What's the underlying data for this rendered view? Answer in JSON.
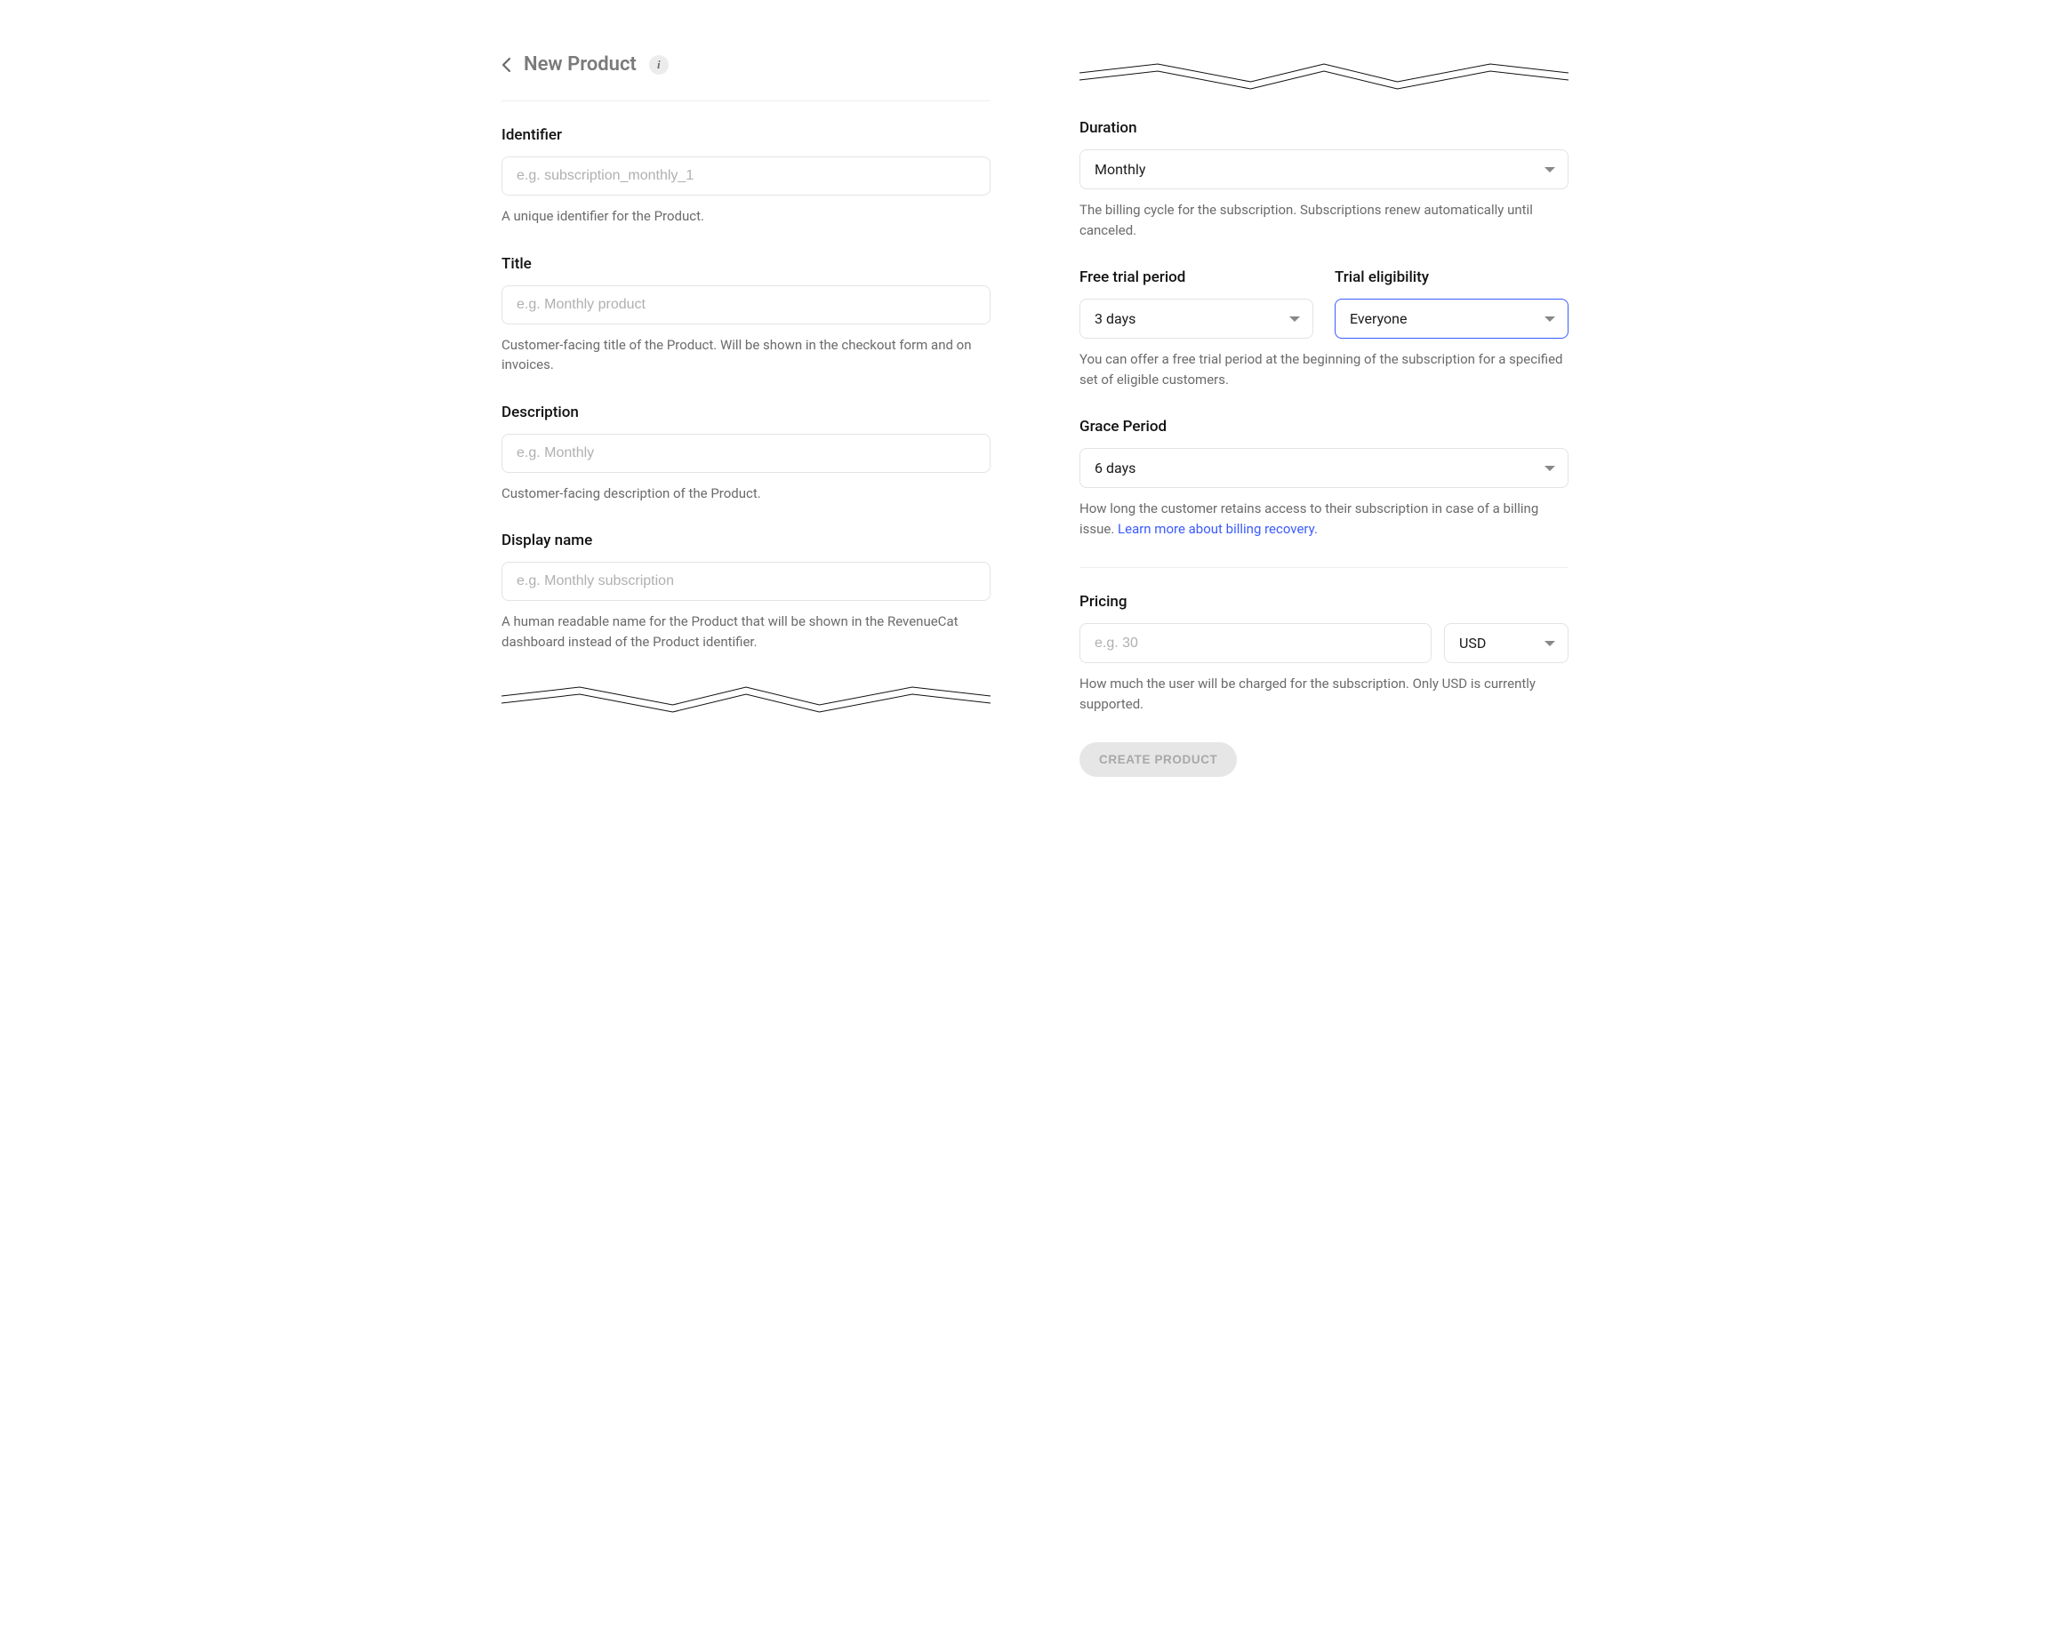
{
  "header": {
    "title": "New Product",
    "info_glyph": "i"
  },
  "left": {
    "identifier": {
      "label": "Identifier",
      "placeholder": "e.g. subscription_monthly_1",
      "help": "A unique identifier for the Product."
    },
    "title_field": {
      "label": "Title",
      "placeholder": "e.g. Monthly product",
      "help": "Customer-facing title of the Product. Will be shown in the checkout form and on invoices."
    },
    "description": {
      "label": "Description",
      "placeholder": "e.g. Monthly",
      "help": "Customer-facing description of the Product."
    },
    "display_name": {
      "label": "Display name",
      "placeholder": "e.g. Monthly subscription",
      "help": "A human readable name for the Product that will be shown in the RevenueCat dashboard instead of the Product identifier."
    }
  },
  "right": {
    "duration": {
      "label": "Duration",
      "value": "Monthly",
      "help": "The billing cycle for the subscription. Subscriptions renew automatically until canceled."
    },
    "free_trial": {
      "label": "Free trial period",
      "value": "3 days"
    },
    "trial_eligibility": {
      "label": "Trial eligibility",
      "value": "Everyone"
    },
    "trial_help": "You can offer a free trial period at the beginning of the subscription for a specified set of eligible customers.",
    "grace_period": {
      "label": "Grace Period",
      "value": "6 days",
      "help_pre": "How long the customer retains access to their subscription in case of a billing issue. ",
      "help_link": "Learn more about billing recovery.",
      "help_post": ""
    },
    "pricing": {
      "label": "Pricing",
      "placeholder": "e.g. 30",
      "currency": "USD",
      "help": "How much the user will be charged for the subscription. Only USD is currently supported."
    },
    "create_btn": "CREATE PRODUCT"
  }
}
